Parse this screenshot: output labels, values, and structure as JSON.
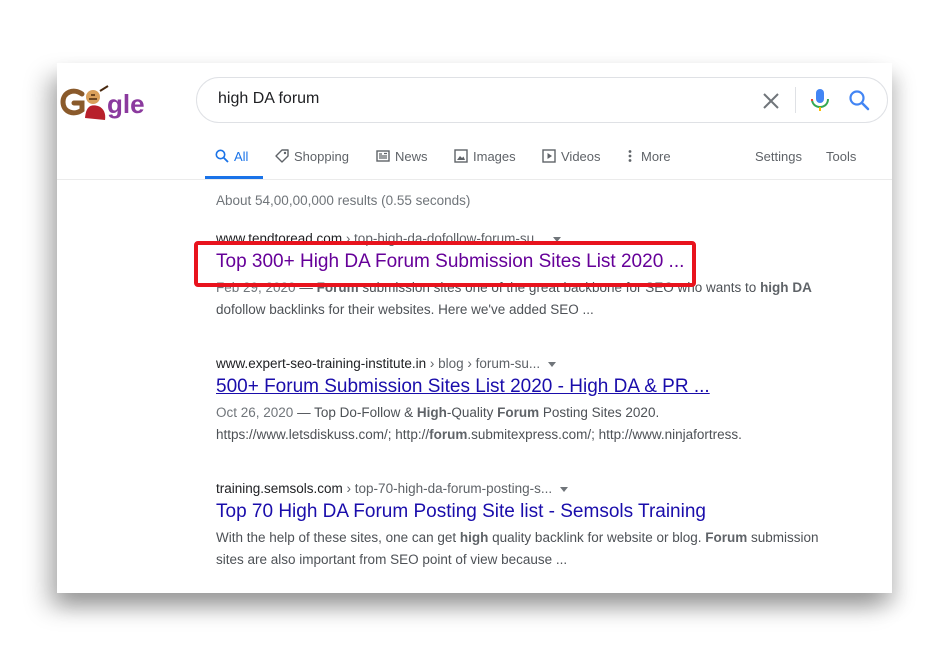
{
  "search": {
    "query": "high DA forum"
  },
  "tabs": [
    {
      "label": "All",
      "icon": "search-icon",
      "active": true
    },
    {
      "label": "Shopping",
      "icon": "tag-icon"
    },
    {
      "label": "News",
      "icon": "newspaper-icon"
    },
    {
      "label": "Images",
      "icon": "image-icon"
    },
    {
      "label": "Videos",
      "icon": "play-icon"
    },
    {
      "label": "More",
      "icon": "more-vert-icon"
    }
  ],
  "tools": {
    "settings": "Settings",
    "tools": "Tools"
  },
  "stats": "About 54,00,00,000 results (0.55 seconds)",
  "results": [
    {
      "url_domain": "www.tendtoread.com",
      "url_path": " › top-high-da-dofollow-forum-su...",
      "title": "Top 300+ High DA Forum Submission Sites List 2020 ...",
      "title_color": "#660099",
      "date": "Feb 29, 2020",
      "snippet": [
        {
          "t": " — ",
          "b": false
        },
        {
          "t": "Forum",
          "b": true
        },
        {
          "t": " submission sites one of the great backbone for SEO who wants to ",
          "b": false
        },
        {
          "t": "high",
          "b": true
        },
        {
          "t": " ",
          "b": false
        },
        {
          "t": "DA",
          "b": true
        },
        {
          "t": " dofollow backlinks for their websites. Here we've added SEO ...",
          "b": false
        }
      ]
    },
    {
      "url_domain": "www.expert-seo-training-institute.in",
      "url_path": " › blog › forum-su...",
      "title": "500+ Forum Submission Sites List 2020 - High DA & PR ...",
      "title_color": "#1a0dab",
      "date": "Oct 26, 2020",
      "snippet": [
        {
          "t": " — Top Do-Follow & ",
          "b": false
        },
        {
          "t": "High",
          "b": true
        },
        {
          "t": "-Quality ",
          "b": false
        },
        {
          "t": "Forum",
          "b": true
        },
        {
          "t": " Posting Sites 2020. https://www.letsdiskuss.com/; http://",
          "b": false
        },
        {
          "t": "forum",
          "b": true
        },
        {
          "t": ".submitexpress.com/; http://www.ninjafortress.",
          "b": false
        }
      ]
    },
    {
      "url_domain": "training.semsols.com",
      "url_path": " › top-70-high-da-forum-posting-s...",
      "title": "Top 70 High DA Forum Posting Site list - Semsols Training",
      "title_color": "#1a0dab",
      "date": "",
      "snippet": [
        {
          "t": "With the help of these sites, one can get ",
          "b": false
        },
        {
          "t": "high",
          "b": true
        },
        {
          "t": " quality backlink for website or blog. ",
          "b": false
        },
        {
          "t": "Forum",
          "b": true
        },
        {
          "t": " submission sites are also important from SEO point of view because ...",
          "b": false
        }
      ]
    }
  ],
  "colors": {
    "accent": "#1a73e8",
    "highlight": "#e8131d",
    "visited_link": "#660099",
    "link": "#1a0dab"
  }
}
